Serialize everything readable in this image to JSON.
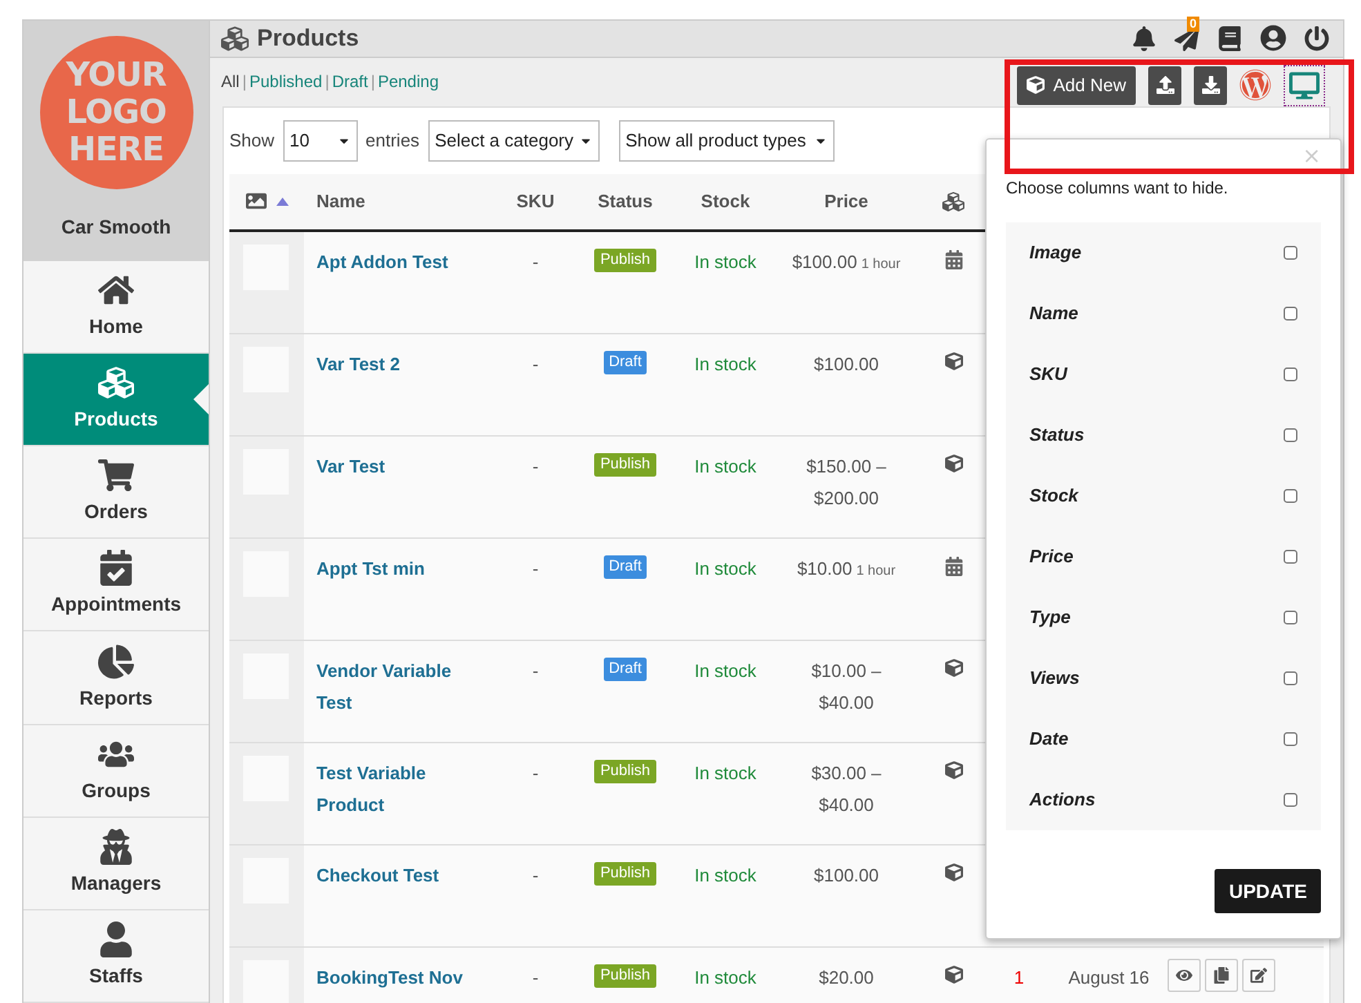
{
  "sidebar": {
    "logo": [
      "YOUR",
      "LOGO",
      "HERE"
    ],
    "store_name": "Car Smooth",
    "items": [
      {
        "label": "Home",
        "selected": false
      },
      {
        "label": "Products",
        "selected": true
      },
      {
        "label": "Orders",
        "selected": false
      },
      {
        "label": "Appointments",
        "selected": false
      },
      {
        "label": "Reports",
        "selected": false
      },
      {
        "label": "Groups",
        "selected": false
      },
      {
        "label": "Managers",
        "selected": false
      },
      {
        "label": "Staffs",
        "selected": false
      }
    ]
  },
  "header": {
    "title": "Products",
    "notification_count": "0"
  },
  "filters": [
    {
      "label": "All",
      "selected": true
    },
    {
      "separator": "|",
      "label": "Published",
      "selected": false
    },
    {
      "separator": "|",
      "label": "Draft",
      "selected": false
    },
    {
      "separator": "|",
      "label": "Pending",
      "selected": false
    }
  ],
  "toolbar": {
    "add_button": "Add New"
  },
  "table_controls": {
    "show_label": "Show",
    "page_size": "10",
    "entries_label": "entries",
    "category": "Select a category",
    "product_type": "Show all product types"
  },
  "table": {
    "columns": [
      "Name",
      "SKU",
      "Status",
      "Stock",
      "Price"
    ],
    "rows": [
      {
        "name": "Apt Addon Test",
        "sku": "-",
        "status": {
          "label": "Publish",
          "kind": "publish"
        },
        "stock": "In stock",
        "price": "$100.00",
        "price_note": "1 hour",
        "kind": "booking"
      },
      {
        "name": "Var Test 2",
        "sku": "-",
        "status": {
          "label": "Draft",
          "kind": "draft"
        },
        "stock": "In stock",
        "price": "$100.00",
        "kind": "product"
      },
      {
        "name": "Var Test",
        "sku": "-",
        "status": {
          "label": "Publish",
          "kind": "publish"
        },
        "stock": "In stock",
        "price": "$150.00 – $200.00",
        "kind": "product"
      },
      {
        "name": "Appt Tst min",
        "sku": "-",
        "status": {
          "label": "Draft",
          "kind": "draft"
        },
        "stock": "In stock",
        "price": "$10.00",
        "price_note": "1 hour",
        "kind": "booking"
      },
      {
        "name": "Vendor Variable Test",
        "sku": "-",
        "status": {
          "label": "Draft",
          "kind": "draft"
        },
        "stock": "In stock",
        "price": "$10.00 – $40.00",
        "kind": "product"
      },
      {
        "name": "Test Variable Product",
        "sku": "-",
        "status": {
          "label": "Publish",
          "kind": "publish"
        },
        "stock": "In stock",
        "price": "$30.00 – $40.00",
        "kind": "product"
      },
      {
        "name": "Checkout Test",
        "sku": "-",
        "status": {
          "label": "Publish",
          "kind": "publish"
        },
        "stock": "In stock",
        "price": "$100.00",
        "kind": "product"
      },
      {
        "name": "BookingTest Nov",
        "sku": "-",
        "status": {
          "label": "Publish",
          "kind": "publish"
        },
        "stock": "In stock",
        "price": "$20.00",
        "kind": "product",
        "views": "1",
        "date": "August 16",
        "actions": true
      }
    ]
  },
  "column_popup": {
    "close": "×",
    "prompt": "Choose columns want to hide.",
    "options": [
      {
        "label": "Image",
        "checked": false
      },
      {
        "label": "Name",
        "checked": false
      },
      {
        "label": "SKU",
        "checked": false
      },
      {
        "label": "Status",
        "checked": false
      },
      {
        "label": "Stock",
        "checked": false
      },
      {
        "label": "Price",
        "checked": false
      },
      {
        "label": "Type",
        "checked": false
      },
      {
        "label": "Views",
        "checked": false
      },
      {
        "label": "Date",
        "checked": false
      },
      {
        "label": "Actions",
        "checked": false
      }
    ],
    "button": "UPDATE"
  }
}
